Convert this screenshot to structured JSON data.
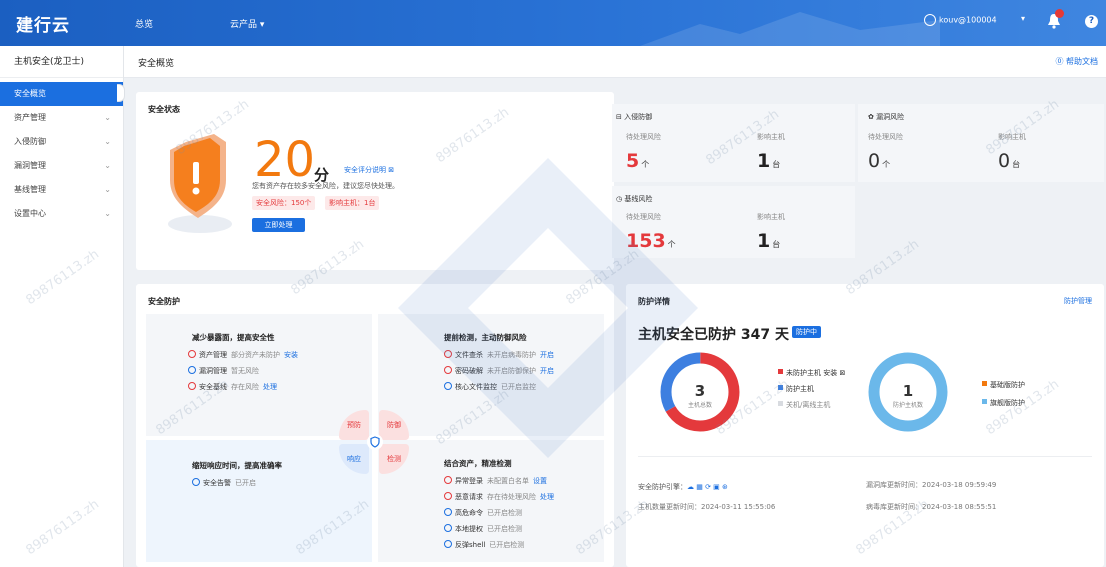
{
  "header": {
    "logo": "建行云",
    "nav": [
      "总览",
      "云产品 ▾"
    ],
    "user": "kouv@100004",
    "user_caret": "▾",
    "help": "?"
  },
  "sidebar": {
    "title": "主机安全(龙卫士)",
    "items": [
      {
        "label": "安全概览",
        "active": true,
        "expandable": false
      },
      {
        "label": "资产管理",
        "active": false,
        "expandable": true
      },
      {
        "label": "入侵防御",
        "active": false,
        "expandable": true
      },
      {
        "label": "漏洞管理",
        "active": false,
        "expandable": true
      },
      {
        "label": "基线管理",
        "active": false,
        "expandable": true
      },
      {
        "label": "设置中心",
        "active": false,
        "expandable": true
      }
    ],
    "chevron": "⌄"
  },
  "breadcrumb": {
    "title": "安全概览",
    "help_link": "⓪ 帮助文档"
  },
  "security_status": {
    "title": "安全状态",
    "score": "20",
    "score_unit": "分",
    "score_link": "安全评分说明 ⊠",
    "desc": "您有资产存在较多安全风险，建议您尽快处理。",
    "tag_risk": "安全风险：150个",
    "tag_host": "影响主机：1台",
    "button": "立即处理"
  },
  "stats": {
    "intrusion": {
      "title": "入侵防御",
      "label1": "待处理风险",
      "value1": "5",
      "unit1": "个",
      "label2": "影响主机",
      "value2": "1",
      "unit2": "台"
    },
    "vuln": {
      "title": "漏洞风险",
      "label1": "待处理风险",
      "value1": "0",
      "unit1": "个",
      "label2": "影响主机",
      "value2": "0",
      "unit2": "台"
    },
    "baseline": {
      "title": "基线风险",
      "label1": "待处理风险",
      "value1": "153",
      "unit1": "个",
      "label2": "影响主机",
      "value2": "1",
      "unit2": "台"
    }
  },
  "protection": {
    "title": "安全防护",
    "q1": {
      "title": "减少暴露面，提高安全性",
      "rows": [
        {
          "icon": "r",
          "name": "资产管理",
          "desc": "部分资产未防护",
          "action": "安装"
        },
        {
          "icon": "b",
          "name": "漏洞管理",
          "desc": "暂无风险",
          "action": ""
        },
        {
          "icon": "r",
          "name": "安全基线",
          "desc": "存在风险",
          "action": "处理"
        }
      ]
    },
    "q2": {
      "title": "提前检测，主动防御风险",
      "rows": [
        {
          "icon": "r",
          "name": "文件查杀",
          "desc": "未开启病毒防护",
          "action": "开启"
        },
        {
          "icon": "r",
          "name": "密码破解",
          "desc": "未开启防御保护",
          "action": "开启"
        },
        {
          "icon": "b",
          "name": "核心文件监控",
          "desc": "已开启监控",
          "action": ""
        }
      ]
    },
    "q3": {
      "title": "缩短响应时间，提高准确率",
      "rows": [
        {
          "icon": "b",
          "name": "安全告警",
          "desc": "已开启",
          "action": ""
        }
      ]
    },
    "q4": {
      "title": "结合资产，精准检测",
      "rows": [
        {
          "icon": "r",
          "name": "异常登录",
          "desc": "未配置白名单",
          "action": "设置"
        },
        {
          "icon": "r",
          "name": "恶意请求",
          "desc": "存在待处理风险",
          "action": "处理"
        },
        {
          "icon": "b",
          "name": "高危命令",
          "desc": "已开启检测",
          "action": ""
        },
        {
          "icon": "b",
          "name": "本地提权",
          "desc": "已开启检测",
          "action": ""
        },
        {
          "icon": "b",
          "name": "反弹shell",
          "desc": "已开启检测",
          "action": ""
        }
      ]
    },
    "petals": [
      "预防",
      "防御",
      "响应",
      "检测"
    ]
  },
  "protection_status": {
    "title": "防护详情",
    "link": "防护管理",
    "headline": "主机安全已防护 347 天",
    "badge": "防护中",
    "donut1": {
      "value": "3",
      "label": "主机总数",
      "legend": [
        {
          "color": "#e4393c",
          "text": "未防护主机 安装 ⊠"
        },
        {
          "color": "#3d7fe0",
          "text": "防护主机"
        },
        {
          "color": "#d8dbe0",
          "text": "关机/离线主机"
        }
      ],
      "segments": [
        {
          "color": "#e4393c",
          "value": 2
        },
        {
          "color": "#3d7fe0",
          "value": 1
        }
      ]
    },
    "donut2": {
      "value": "1",
      "label": "防护主机数",
      "legend": [
        {
          "color": "#f2790f",
          "text": "基础版防护"
        },
        {
          "color": "#6bb8ea",
          "text": "旗舰版防护"
        }
      ],
      "segments": [
        {
          "color": "#6bb8ea",
          "value": 1
        }
      ]
    },
    "footer": {
      "agent_label": "安全防护引擎：",
      "agent_icons": "☁ ▦ ⟳ ▣ ⊛",
      "update_time": "主机数量更新时间：2024-03-11 15:55:06",
      "vuln_time": "漏洞库更新时间：2024-03-18 09:59:49",
      "virus_time": "病毒库更新时间：2024-03-18 08:55:51"
    }
  },
  "watermark": "89876113.zh"
}
